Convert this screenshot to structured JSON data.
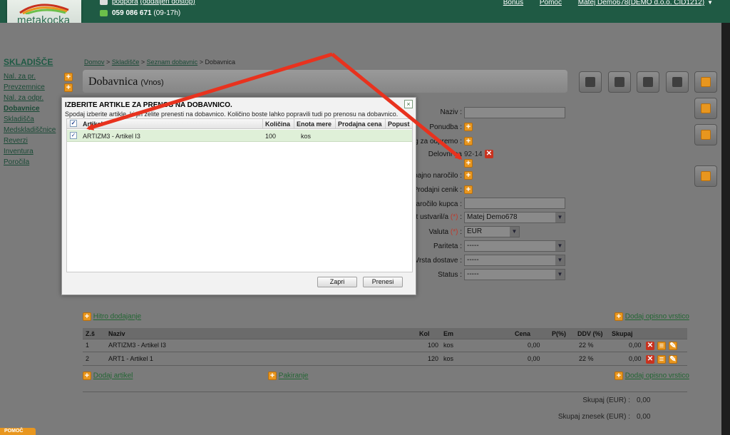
{
  "header": {
    "logo_text": "metakocka",
    "support_label": "podpora",
    "support_link": "(oddaljen dostop)",
    "phone": "059 086 671",
    "phone_hours": "(09-17h)",
    "bonus": "Bonus",
    "help": "Pomoč",
    "user": "Matej Demo678(DEMO d.o.o. CID1212)"
  },
  "sidebar": {
    "title": "SKLADIŠČE",
    "items": [
      {
        "label": "Nal. za pr."
      },
      {
        "label": "Prevzemnice"
      },
      {
        "label": "Nal. za odpr."
      },
      {
        "label": "Dobavnice"
      },
      {
        "label": "Skladišča"
      },
      {
        "label": "Medskladiščnice"
      },
      {
        "label": "Reverzi"
      },
      {
        "label": "Inventura"
      },
      {
        "label": "Poročila"
      }
    ]
  },
  "breadcrumb": {
    "home": "Domov",
    "sep": ">",
    "warehouse": "Skladišče",
    "list": "Seznam dobavnic",
    "current": "Dobavnica"
  },
  "page": {
    "title": "Dobavnica",
    "subtitle": "(Vnos)"
  },
  "form": {
    "naziv": "Naziv :",
    "ponudba": "Ponudba :",
    "nalog": "g za odpremo :",
    "delovni": "Delovni na",
    "delovni_value": "92-14",
    "narocilo": "bajno naročilo :",
    "cenik": "Prodajni cenik :",
    "kupca": "naročilo kupca :",
    "ustvaril": "t ustvaril/a",
    "ustvaril_value": "Matej Demo678",
    "valuta": "Valuta",
    "valuta_value": "EUR",
    "pariteta": "Pariteta :",
    "pariteta_value": "-----",
    "dostava": "Vrsta dostave :",
    "dostava_value": "-----",
    "status": "Status :",
    "status_value": "-----",
    "required": "(*)",
    "colon": ":"
  },
  "actions": {
    "hitro": "Hitro dodajanje",
    "opisno_top": "Dodaj opisno vrstico",
    "dodaj_artikel": "Dodaj artikel",
    "pakiranje": "Pakiranje",
    "opisno_bottom": "Dodaj opisno vrstico"
  },
  "table": {
    "headers": [
      "Z.š",
      "Naziv",
      "Kol",
      "Em",
      "Cena",
      "P(%)",
      "DDV (%)",
      "Skupaj"
    ],
    "rows": [
      {
        "zs": "1",
        "naziv": "ARTIZM3 - Artikel I3",
        "kol": "100",
        "em": "kos",
        "cena": "0,00",
        "p": "",
        "ddv": "22 %",
        "skupaj": "0,00"
      },
      {
        "zs": "2",
        "naziv": "ART1 - Artikel 1",
        "kol": "120",
        "em": "kos",
        "cena": "0,00",
        "p": "",
        "ddv": "22 %",
        "skupaj": "0,00"
      }
    ]
  },
  "totals": {
    "skupaj_label": "Skupaj (EUR) :",
    "skupaj_value": "0,00",
    "znesek_label": "Skupaj znesek (EUR) :",
    "znesek_value": "0,00"
  },
  "modal": {
    "title": "IZBERITE ARTIKLE ZA PRENOS NA DOBAVNICO.",
    "subtitle": "Spodaj izberite artikle, ki jih želite prenesti na dobavnico. Količino boste lahko popravili tudi po prenosu na dobavnico.",
    "close": "×",
    "headers": [
      "Artikel",
      "Količina",
      "Enota mere",
      "Prodajna cena",
      "Popust"
    ],
    "rows": [
      {
        "artikel": "ARTIZM3 - Artikel I3",
        "kolicina": "100",
        "enota": "kos",
        "cena": "",
        "popust": "",
        "checked": true
      }
    ],
    "close_button": "Zapri",
    "transfer_button": "Prenesi"
  },
  "footer": {
    "help": "POMOČ"
  },
  "colors": {
    "topbar": "#1f5a44",
    "accent_orange": "#e8961e",
    "annotation_red": "#e8321e",
    "row_highlight": "#dff0d8"
  },
  "icons": [
    "plus-icon",
    "delete-icon",
    "edit-icon",
    "print-icon",
    "mail-icon",
    "settings-icon",
    "copy-icon",
    "split-icon",
    "checkbox-icon"
  ]
}
